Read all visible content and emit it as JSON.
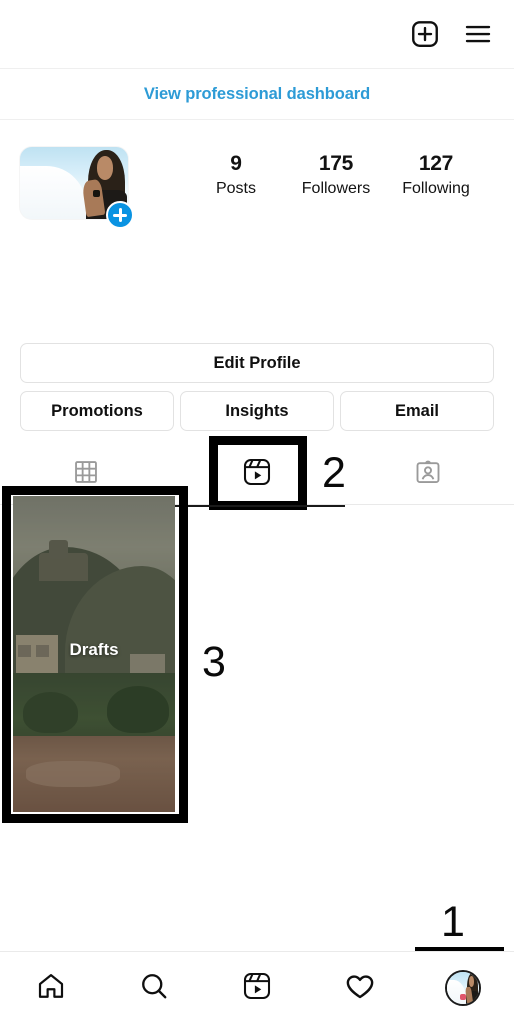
{
  "app": "Instagram",
  "topbar": {
    "add_icon": "plus-square-icon",
    "menu_icon": "hamburger-menu-icon"
  },
  "dashboard": {
    "link_label": "View professional dashboard",
    "link_color": "#2d9bd6"
  },
  "profile": {
    "avatar_icon": "profile-avatar",
    "add_story_icon": "plus-badge-icon",
    "stats": [
      {
        "num": "9",
        "label": "Posts"
      },
      {
        "num": "175",
        "label": "Followers"
      },
      {
        "num": "127",
        "label": "Following"
      }
    ]
  },
  "actions": {
    "edit_profile": "Edit Profile",
    "buttons": [
      {
        "label": "Promotions"
      },
      {
        "label": "Insights"
      },
      {
        "label": "Email"
      }
    ]
  },
  "tabs": [
    {
      "name": "grid",
      "icon": "grid-icon",
      "selected": false
    },
    {
      "name": "reels",
      "icon": "reels-icon",
      "selected": true
    },
    {
      "name": "tagged",
      "icon": "tagged-person-icon",
      "selected": false
    }
  ],
  "content": {
    "draft_label": "Drafts"
  },
  "annotations": [
    {
      "id": "1",
      "target": "profile-tab-nav-button",
      "number": "1"
    },
    {
      "id": "2",
      "target": "reels-tab",
      "number": "2"
    },
    {
      "id": "3",
      "target": "drafts-thumbnail",
      "number": "3"
    }
  ],
  "bottom_nav": [
    {
      "name": "home",
      "icon": "home-icon"
    },
    {
      "name": "search",
      "icon": "search-icon"
    },
    {
      "name": "reels",
      "icon": "reels-icon"
    },
    {
      "name": "activity",
      "icon": "heart-icon"
    },
    {
      "name": "profile",
      "icon": "profile-avatar-icon"
    }
  ]
}
